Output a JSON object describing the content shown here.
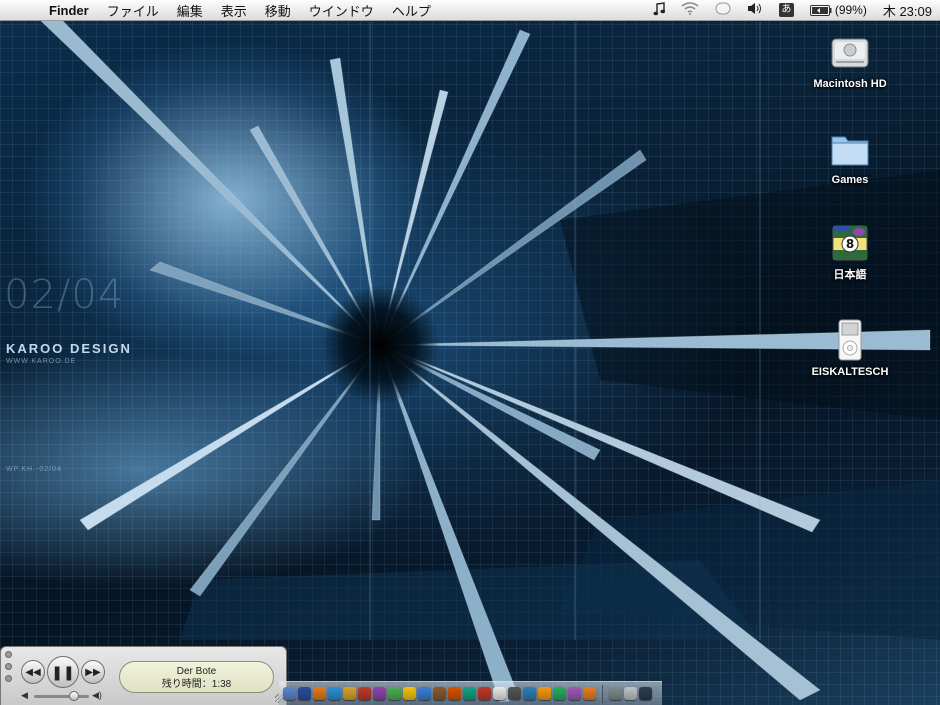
{
  "menubar": {
    "apple_glyph": "",
    "app_name": "Finder",
    "menus": [
      "ファイル",
      "編集",
      "表示",
      "移動",
      "ウインドウ",
      "ヘルプ"
    ],
    "status": {
      "input_method": "あ",
      "battery": "(99%)",
      "clock": "木 23:09"
    }
  },
  "wallpaper": {
    "date": "02/04",
    "brand": "KAROO DESIGN",
    "url": "WWW.KAROO.DE",
    "code": "WP.KH.-02/04"
  },
  "desktop_icons": [
    {
      "label": "Macintosh HD",
      "icon": "hard-drive-icon"
    },
    {
      "label": "Games",
      "icon": "folder-icon"
    },
    {
      "label": "日本語",
      "icon": "language-app-icon"
    },
    {
      "label": "EISKALTESCH",
      "icon": "ipod-icon"
    }
  ],
  "mini_player": {
    "track": "Der Bote",
    "remaining": "残り時間：1:38",
    "volume_level": 0.72
  },
  "dock": {
    "colors": [
      "#5b87c9",
      "#2a4fa0",
      "#e37b1c",
      "#2c8fd6",
      "#d8a42b",
      "#c0392b",
      "#8e44ad",
      "#4caf50",
      "#f1c40f",
      "#3a7fd5",
      "#8b5a2b",
      "#d35400",
      "#16a085",
      "#c0392b",
      "#e8e8e8",
      "#555555",
      "#2980b9",
      "#f39c12",
      "#27ae60",
      "#9b59b6",
      "#e67e22",
      "#7f8c8d",
      "#bdc3c7",
      "#2c3e50"
    ]
  }
}
